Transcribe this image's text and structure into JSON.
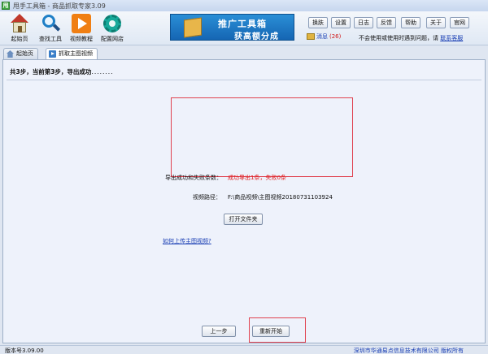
{
  "window": {
    "title": "甩手工具箱 - 商品抓取专家3.09"
  },
  "toolbar": {
    "buttons": [
      {
        "label": "起始页",
        "icon": "home-icon"
      },
      {
        "label": "查找工具",
        "icon": "search-icon"
      },
      {
        "label": "视频教程",
        "icon": "video-play-icon"
      },
      {
        "label": "配置网店",
        "icon": "gear-icon"
      }
    ],
    "banner": {
      "line1": "推广工具箱",
      "line2": "获高额分成"
    },
    "small_buttons": [
      "换肤",
      "设置",
      "日志",
      "反馈",
      "帮助",
      "关于",
      "官网"
    ],
    "message_label": "消息",
    "message_count": "(26)",
    "notice_text": "不会使用或使用时遇到问题，请",
    "notice_link": "联系客服"
  },
  "tabs": [
    {
      "label": "起始页",
      "icon": "home-icon",
      "active": false
    },
    {
      "label": "抓取主图视频",
      "icon": "video-icon",
      "active": true
    }
  ],
  "main": {
    "step_text": "共3步，当前第3步，导出成功",
    "step_dots": "........",
    "result_label": "导出成功和失败条数：",
    "result_value": "成功导出1条，失败0条",
    "path_label": "视频路径：",
    "path_value": "F:\\商品视频\\主图视频20180731103924",
    "open_folder_button": "打开文件夹",
    "upload_link": "如何上传主图视频?",
    "prev_button": "上一步",
    "restart_button": "重新开始"
  },
  "status": {
    "version": "版本号3.09.00",
    "copyright": "深圳市华通易点信息技术有限公司 版权所有"
  },
  "colors": {
    "accent_red": "#e01e1e",
    "link_blue": "#1a3fb4",
    "banner_blue": "#1565b3",
    "highlight_frame": "#e0424f"
  }
}
